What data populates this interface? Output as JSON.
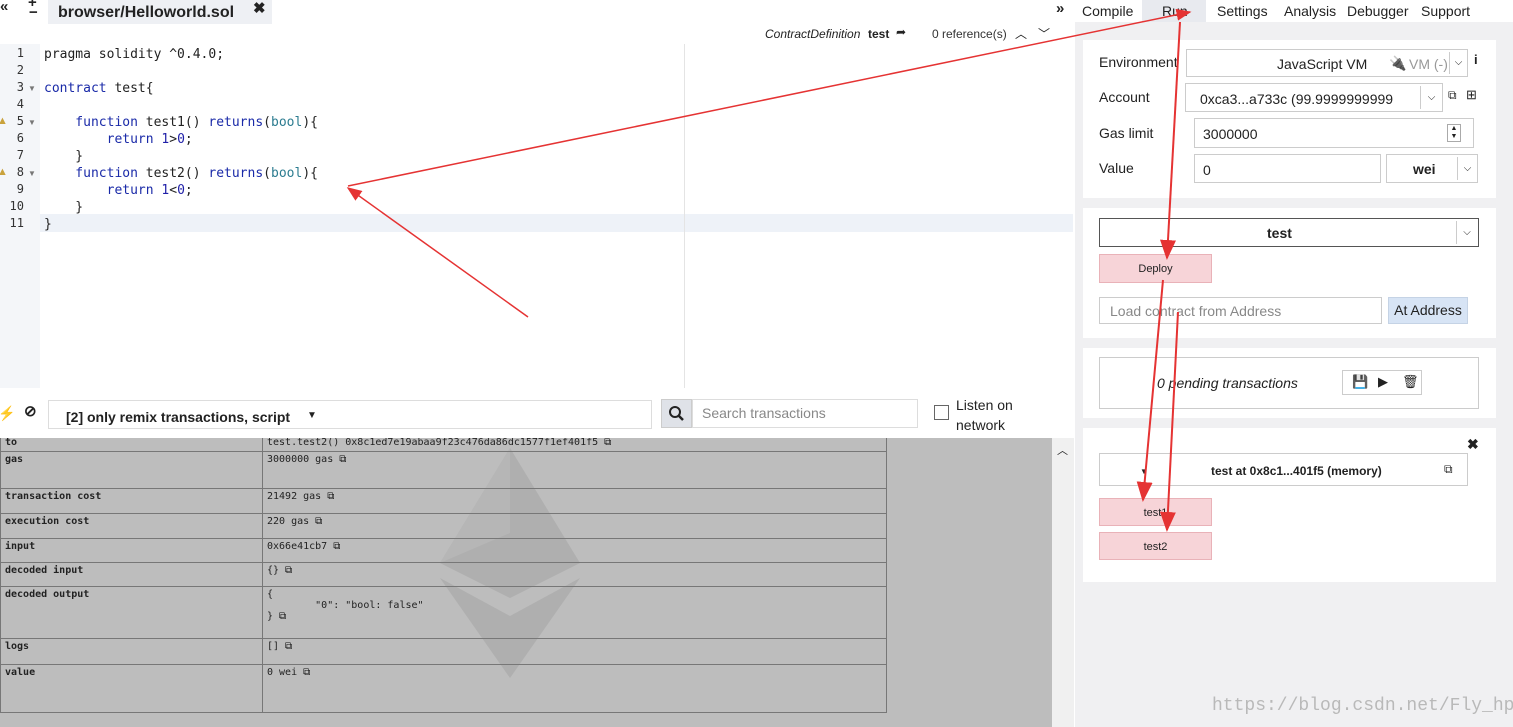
{
  "tabs": {
    "file": "browser/Helloworld.sol"
  },
  "defbar": {
    "kind": "ContractDefinition",
    "name": "test",
    "refs": "0 reference(s)"
  },
  "editor": {
    "line_numbers": [
      "1",
      "2",
      "3",
      "4",
      "5",
      "6",
      "7",
      "8",
      "9",
      "10",
      "11"
    ],
    "lines": [
      [
        {
          "c": "pragma solidity ",
          "s": ""
        },
        {
          "c": "^0.4.0;",
          "s": ""
        }
      ],
      [],
      [
        {
          "c": "contract ",
          "s": "kw"
        },
        {
          "c": "test{",
          "s": ""
        }
      ],
      [],
      [
        {
          "c": "    function ",
          "s": "kw"
        },
        {
          "c": "test1() ",
          "s": ""
        },
        {
          "c": "returns",
          "s": "kw"
        },
        {
          "c": "(",
          "s": ""
        },
        {
          "c": "bool",
          "s": "ty"
        },
        {
          "c": "){",
          "s": ""
        }
      ],
      [
        {
          "c": "        return ",
          "s": "kw"
        },
        {
          "c": "1",
          "s": "nu"
        },
        {
          "c": ">",
          "s": ""
        },
        {
          "c": "0",
          "s": "nu"
        },
        {
          "c": ";",
          "s": ""
        }
      ],
      [
        {
          "c": "    }",
          "s": ""
        }
      ],
      [
        {
          "c": "    function ",
          "s": "kw"
        },
        {
          "c": "test2() ",
          "s": ""
        },
        {
          "c": "returns",
          "s": "kw"
        },
        {
          "c": "(",
          "s": ""
        },
        {
          "c": "bool",
          "s": "ty"
        },
        {
          "c": "){",
          "s": ""
        }
      ],
      [
        {
          "c": "        return ",
          "s": "kw"
        },
        {
          "c": "1",
          "s": "nu"
        },
        {
          "c": "<",
          "s": ""
        },
        {
          "c": "0",
          "s": "nu"
        },
        {
          "c": ";",
          "s": ""
        }
      ],
      [
        {
          "c": "    }",
          "s": ""
        }
      ],
      [
        {
          "c": "}",
          "s": ""
        }
      ]
    ]
  },
  "terminal": {
    "filter_label": "[2] only remix transactions, script",
    "search_placeholder": "Search transactions",
    "listen_label": "Listen on network",
    "rows": [
      {
        "key": "to",
        "value": "test.test2() 0x8c1ed7e19abaa9f23c476da86dc1577f1ef401f5"
      },
      {
        "key": "gas",
        "value": "3000000 gas"
      },
      {
        "key": "transaction cost",
        "value": "21492 gas"
      },
      {
        "key": "execution cost",
        "value": "220 gas"
      },
      {
        "key": "input",
        "value": "0x66e41cb7"
      },
      {
        "key": "decoded input",
        "value": "{}"
      },
      {
        "key": "decoded output",
        "value": "{\n        \"0\": \"bool: false\"\n}"
      },
      {
        "key": "logs",
        "value": "[]"
      },
      {
        "key": "value",
        "value": "0 wei"
      }
    ]
  },
  "menu": {
    "compile": "Compile",
    "run": "Run",
    "settings": "Settings",
    "analysis": "Analysis",
    "debugger": "Debugger",
    "support": "Support"
  },
  "run": {
    "env_label": "Environment",
    "env_value": "JavaScript VM",
    "env_vm": "VM (-)",
    "account_label": "Account",
    "account_value": "0xca3...a733c (99.9999999999",
    "gas_label": "Gas limit",
    "gas_value": "3000000",
    "value_label": "Value",
    "value_value": "0",
    "value_unit": "wei",
    "contract_select": "test",
    "deploy": "Deploy",
    "address_placeholder": "Load contract from Address",
    "at_address": "At Address",
    "pending": "0 pending transactions",
    "instance_title": "test at 0x8c1...401f5 (memory)",
    "fn1": "test1",
    "fn2": "test2"
  },
  "watermark": "https://blog.csdn.net/Fly_hps"
}
